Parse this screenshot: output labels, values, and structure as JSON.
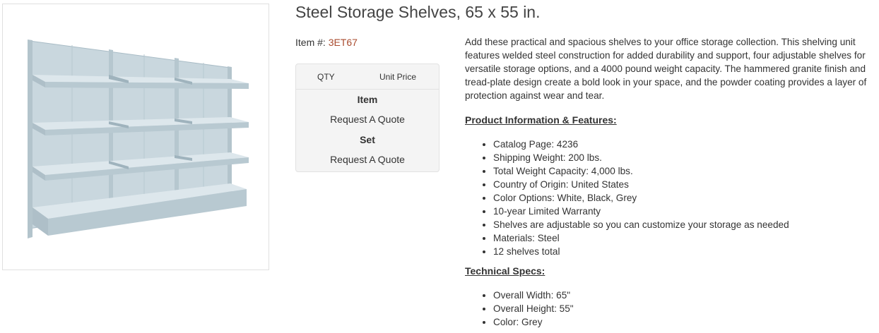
{
  "product": {
    "title": "Steel Storage Shelves, 65 x 55 in.",
    "item_label": "Item #:",
    "item_number": "3ET67",
    "image_alt": "steel shelving unit"
  },
  "pricing": {
    "qty_header": "QTY",
    "unit_price_header": "Unit Price",
    "rows": [
      {
        "label": "Item",
        "value": "Request A Quote"
      },
      {
        "label": "Set",
        "value": "Request A Quote"
      }
    ]
  },
  "description": "Add these practical and spacious shelves to your office storage collection. This shelving unit features welded steel construction for added durability and support, four adjustable shelves for versatile storage options, and a 4000 pound weight capacity. The hammered granite finish and tread-plate design create a bold look in your space, and the powder coating provides a layer of protection against wear and tear.",
  "features": {
    "heading": "Product Information & Features:",
    "items": [
      "Catalog Page: 4236",
      "Shipping Weight: 200 lbs.",
      "Total Weight Capacity: 4,000 lbs.",
      "Country of Origin: United States",
      "Color Options: White, Black, Grey",
      "10-year Limited Warranty",
      "Shelves are adjustable so you can customize your storage as needed",
      "Materials: Steel",
      "12 shelves total"
    ]
  },
  "tech_specs": {
    "heading": "Technical Specs:",
    "items": [
      "Overall Width: 65\"",
      "Overall Height: 55\"",
      "Color: Grey"
    ]
  },
  "colors": {
    "item_code": "#a94b2e",
    "shelf": "#c4d4dc",
    "shelf_dark": "#9fb3bd"
  }
}
